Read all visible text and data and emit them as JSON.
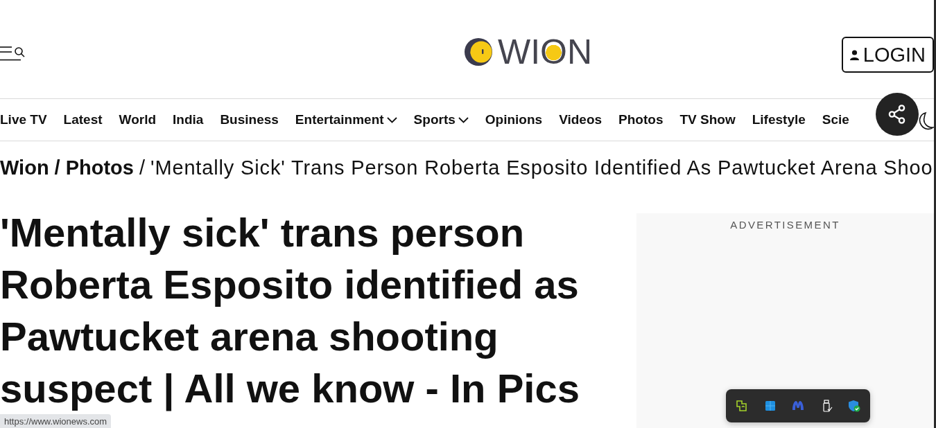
{
  "logo": {
    "text": "WION"
  },
  "login_button": {
    "label": "LOGIN"
  },
  "nav": {
    "items": [
      {
        "label": "Live TV",
        "kind": "link"
      },
      {
        "label": "Latest",
        "kind": "link"
      },
      {
        "label": "World",
        "kind": "link"
      },
      {
        "label": "India",
        "kind": "link"
      },
      {
        "label": "Business",
        "kind": "link"
      },
      {
        "label": "Entertainment",
        "kind": "dropdown"
      },
      {
        "label": "Sports",
        "kind": "dropdown"
      },
      {
        "label": "Opinions",
        "kind": "link"
      },
      {
        "label": "Videos",
        "kind": "link"
      },
      {
        "label": "Photos",
        "kind": "link"
      },
      {
        "label": "TV Show",
        "kind": "link"
      },
      {
        "label": "Lifestyle",
        "kind": "link"
      },
      {
        "label": "Scie",
        "kind": "link"
      }
    ]
  },
  "breadcrumb": [
    {
      "label": "Wion",
      "kind": "link"
    },
    {
      "separator": "/",
      "label": "Photos",
      "kind": "link"
    },
    {
      "separator": "/",
      "label": "'Mentally Sick' Trans Person Roberta Esposito Identified As Pawtucket Arena Shoo",
      "kind": "current"
    }
  ],
  "article": {
    "headline": "'Mentally sick' trans person Roberta Esposito identified as Pawtucket arena shooting suspect | All we know - In Pics"
  },
  "advertisement": {
    "label": "ADVERTISEMENT"
  },
  "status_bar": {
    "url": "https://www.wionews.com"
  }
}
